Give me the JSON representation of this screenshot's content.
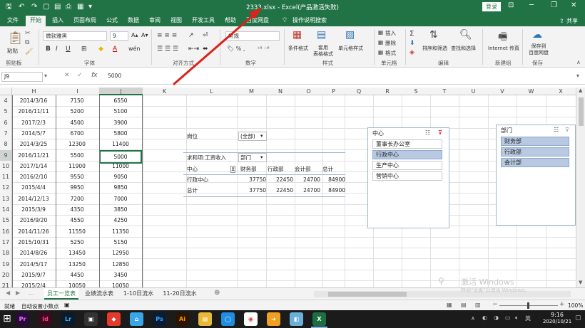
{
  "window": {
    "title": "2333.xlsx - Excel(产品激活失败)",
    "login": "登录",
    "share": "共享"
  },
  "tabs": [
    "文件",
    "开始",
    "插入",
    "页面布局",
    "公式",
    "数据",
    "审阅",
    "视图",
    "开发工具",
    "帮助",
    "百度网盘",
    "操作说明搜索"
  ],
  "ribbon": {
    "paste": "粘贴",
    "font_name": "微软雅黑",
    "font_size": "9",
    "number_format": "常规",
    "cond_format": "条件格式",
    "table_format": "套用\n表格格式",
    "cell_style": "单元格样式",
    "insert": "插入",
    "delete": "删除",
    "format": "格式",
    "sort_filter": "排序和筛选",
    "find_select": "查找和选择",
    "internet_fax": "Internet 传真",
    "save_baidu": "保存到\n百度网盘",
    "groups": [
      "剪贴板",
      "字体",
      "对齐方式",
      "数字",
      "样式",
      "单元格",
      "编辑",
      "新建组",
      "保存"
    ]
  },
  "formula_bar": {
    "name_box": "J9",
    "value": "5000"
  },
  "columns": [
    "H",
    "I",
    "J",
    "K",
    "L",
    "M",
    "N",
    "O",
    "P",
    "Q",
    "R",
    "S",
    "T",
    "U",
    "V",
    "W",
    "X"
  ],
  "rows": [
    {
      "n": "4",
      "h": "2014/3/16",
      "i": "7150",
      "j": "6550"
    },
    {
      "n": "5",
      "h": "2016/11/11",
      "i": "5200",
      "j": "5100"
    },
    {
      "n": "6",
      "h": "2017/2/3",
      "i": "4500",
      "j": "3900"
    },
    {
      "n": "7",
      "h": "2014/5/7",
      "i": "6700",
      "j": "5800"
    },
    {
      "n": "8",
      "h": "2014/3/25",
      "i": "12300",
      "j": "11400"
    },
    {
      "n": "9",
      "h": "2016/11/21",
      "i": "5500",
      "j": "5000"
    },
    {
      "n": "10",
      "h": "2017/1/14",
      "i": "11900",
      "j": "11000"
    },
    {
      "n": "11",
      "h": "2016/2/10",
      "i": "9550",
      "j": "9050"
    },
    {
      "n": "12",
      "h": "2015/4/4",
      "i": "9950",
      "j": "9850"
    },
    {
      "n": "13",
      "h": "2014/12/13",
      "i": "7200",
      "j": "7000"
    },
    {
      "n": "14",
      "h": "2015/3/9",
      "i": "4350",
      "j": "3850"
    },
    {
      "n": "15",
      "h": "2016/9/20",
      "i": "4550",
      "j": "4250"
    },
    {
      "n": "16",
      "h": "2014/11/26",
      "i": "11550",
      "j": "11350"
    },
    {
      "n": "17",
      "h": "2015/10/31",
      "i": "5250",
      "j": "5150"
    },
    {
      "n": "18",
      "h": "2014/8/26",
      "i": "13450",
      "j": "12950"
    },
    {
      "n": "19",
      "h": "2014/5/17",
      "i": "13250",
      "j": "12850"
    },
    {
      "n": "20",
      "h": "2015/9/7",
      "i": "4450",
      "j": "3450"
    },
    {
      "n": "21",
      "h": "2015/2/4",
      "i": "10050",
      "j": "10050"
    }
  ],
  "pivot": {
    "filter_label": "岗位",
    "filter_value": "(全部)",
    "value_label": "求和项:工资收入",
    "col_field": "部门",
    "row_field": "中心",
    "col_headers": [
      "财务部",
      "行政部",
      "会计部",
      "总计"
    ],
    "body": [
      {
        "label": "行政中心",
        "vals": [
          "37750",
          "22450",
          "24700",
          "84900"
        ]
      },
      {
        "label": "总计",
        "vals": [
          "37750",
          "22450",
          "24700",
          "84900"
        ]
      }
    ]
  },
  "slicer_center": {
    "title": "中心",
    "items": [
      {
        "t": "董事长办公室",
        "sel": false
      },
      {
        "t": "行政中心",
        "sel": true
      },
      {
        "t": "生产中心",
        "sel": false
      },
      {
        "t": "营销中心",
        "sel": false
      }
    ]
  },
  "slicer_dept": {
    "title": "部门",
    "items": [
      {
        "t": "财务部",
        "sel": true
      },
      {
        "t": "行政部",
        "sel": true
      },
      {
        "t": "会计部",
        "sel": true
      }
    ]
  },
  "sheets": [
    "员工一览表",
    "业绩流水表",
    "1-10日流水",
    "11-20日流水"
  ],
  "status": {
    "ready": "就绪",
    "autosave": "自动设置小数点",
    "zoom": "100%"
  },
  "watermark": {
    "line1": "激活 Windows",
    "line2": "转到\"设置\"以激活 Windows。"
  },
  "clock": {
    "time": "9:16",
    "date": "2020/10/21"
  },
  "taskbar_apps": [
    {
      "label": "Pr",
      "bg": "#2a0a3a",
      "fg": "#ea77ff"
    },
    {
      "label": "Id",
      "bg": "#3b0a1d",
      "fg": "#ff3f8a"
    },
    {
      "label": "Lr",
      "bg": "#0a1c2c",
      "fg": "#3dafef"
    },
    {
      "label": "▣",
      "bg": "#333333",
      "fg": "#ffffff"
    },
    {
      "label": "◆",
      "bg": "#e33a2c",
      "fg": "#ffffff"
    },
    {
      "label": "⌂",
      "bg": "#3aa6e8",
      "fg": "#ffffff"
    },
    {
      "label": "Ps",
      "bg": "#0a1c33",
      "fg": "#31a8ff"
    },
    {
      "label": "Ai",
      "bg": "#2b1400",
      "fg": "#ff9a00"
    },
    {
      "label": "▤",
      "bg": "#e8b83a",
      "fg": "#ffffff"
    },
    {
      "label": "◯",
      "bg": "#1f8de0",
      "fg": "#ffffff"
    },
    {
      "label": "◉",
      "bg": "#ffffff",
      "fg": "#e53935"
    },
    {
      "label": "➜",
      "bg": "#f0a020",
      "fg": "#ffffff"
    },
    {
      "label": "◧",
      "bg": "#6bb0d8",
      "fg": "#ffffff"
    },
    {
      "label": "X",
      "bg": "#1d6f42",
      "fg": "#ffffff"
    }
  ]
}
